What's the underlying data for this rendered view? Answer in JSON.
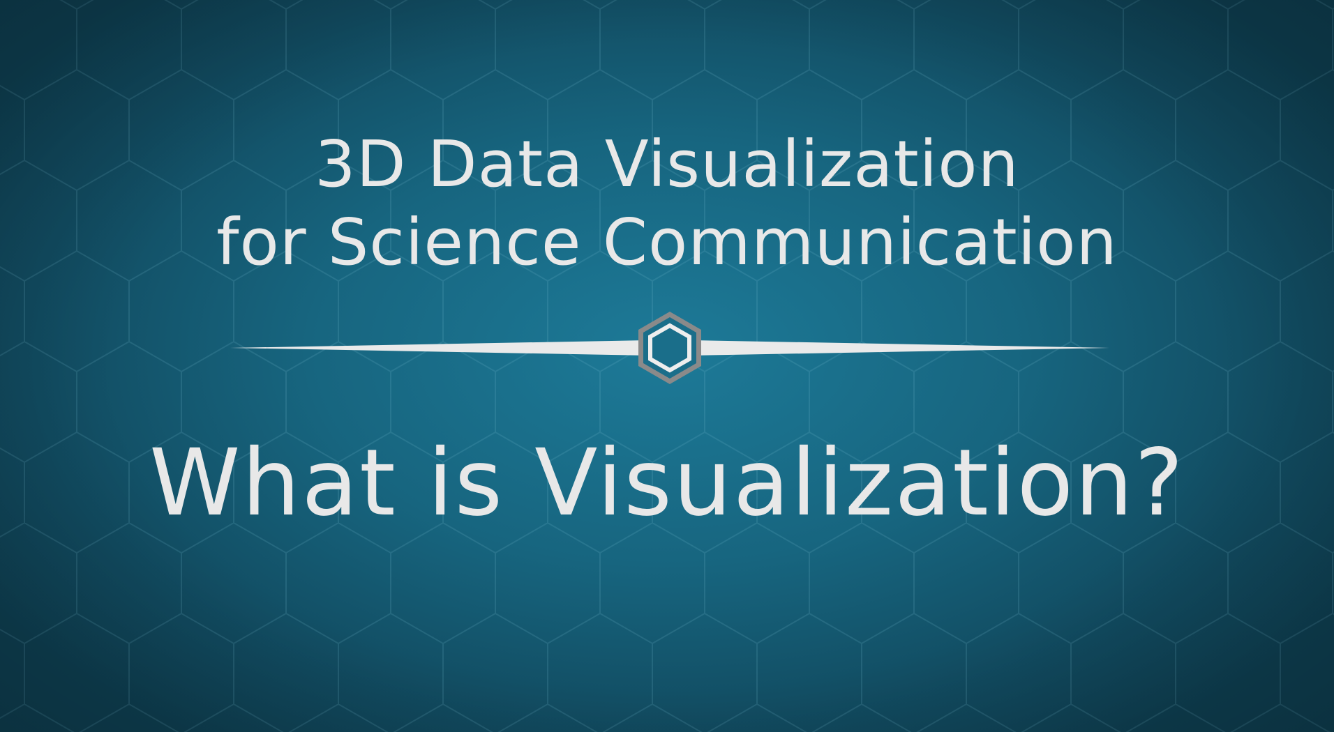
{
  "slide": {
    "course_title_line1": "3D Data Visualization",
    "course_title_line2": "for Science Communication",
    "lesson_title": "What is Visualization?"
  },
  "colors": {
    "background_center": "#1d7a98",
    "background_edge": "#0e3e50",
    "text": "#e8e8e8",
    "emblem": "#8a8a8a"
  },
  "icons": {
    "divider_emblem": "hexagon-icon",
    "background_pattern": "hexagon-grid"
  }
}
